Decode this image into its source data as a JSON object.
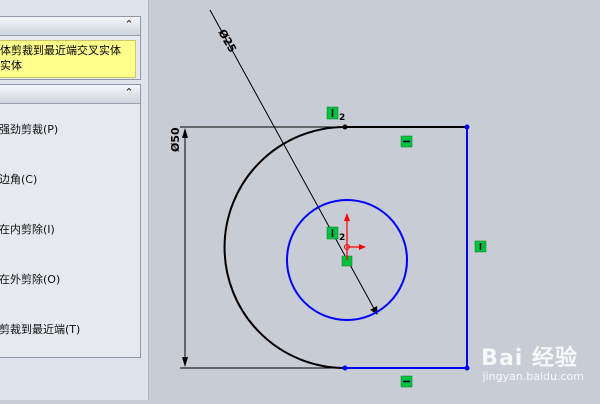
{
  "panel_top": {
    "message_line1": "体剪裁到最近端交叉实体",
    "message_line2": "实体"
  },
  "panel_options": {
    "items": [
      {
        "label": "强劲剪裁(P)"
      },
      {
        "label": "边角(C)"
      },
      {
        "label": "在内剪除(I)"
      },
      {
        "label": "在外剪除(O)"
      },
      {
        "label": "剪裁到最近端(T)"
      }
    ]
  },
  "sketch": {
    "dim_small_circle": "Ø25",
    "dim_large_arc": "Ø50",
    "relation_numbers": [
      "2",
      "2"
    ]
  },
  "watermark": {
    "main": "Bai 经验",
    "sub": "jingyan.baidu.com"
  },
  "colors": {
    "sketch_blue": "#0000ff",
    "sketch_black": "#000000",
    "relation_green": "#00c040",
    "origin_red": "#ff0000"
  }
}
